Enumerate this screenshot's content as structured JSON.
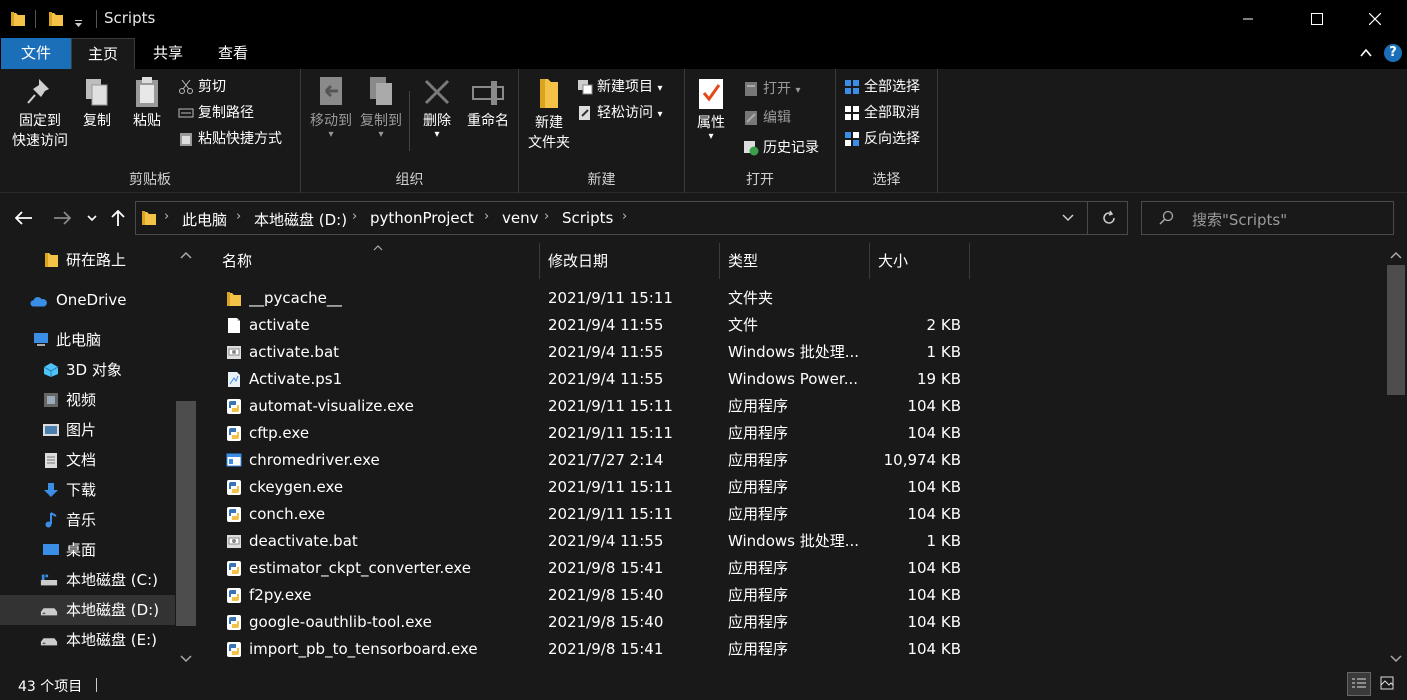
{
  "window": {
    "title": "Scripts"
  },
  "ribbon_tabs": {
    "file": "文件",
    "home": "主页",
    "share": "共享",
    "view": "查看"
  },
  "ribbon": {
    "clipboard": {
      "label": "剪贴板",
      "pin_line1": "固定到",
      "pin_line2": "快速访问",
      "copy": "复制",
      "paste": "粘贴",
      "cut": "剪切",
      "copy_path": "复制路径",
      "paste_shortcut": "粘贴快捷方式"
    },
    "organize": {
      "label": "组织",
      "move_to": "移动到",
      "copy_to": "复制到",
      "delete": "删除",
      "rename": "重命名"
    },
    "new": {
      "label": "新建",
      "new_folder_line1": "新建",
      "new_folder_line2": "文件夹",
      "new_item": "新建项目",
      "easy_access": "轻松访问"
    },
    "open": {
      "label": "打开",
      "properties": "属性",
      "open": "打开",
      "edit": "编辑",
      "history": "历史记录"
    },
    "select": {
      "label": "选择",
      "select_all": "全部选择",
      "select_none": "全部取消",
      "invert": "反向选择"
    }
  },
  "address": {
    "crumbs": [
      "此电脑",
      "本地磁盘 (D:)",
      "pythonProject",
      "venv",
      "Scripts"
    ],
    "search_placeholder": "搜索\"Scripts\""
  },
  "nav_pane": {
    "items": [
      {
        "label": "研在路上",
        "icon": "folder-icon"
      },
      {
        "label": "OneDrive",
        "icon": "onedrive-icon"
      },
      {
        "label": "此电脑",
        "icon": "computer-icon"
      },
      {
        "label": "3D 对象",
        "icon": "3d-objects-icon"
      },
      {
        "label": "视频",
        "icon": "videos-icon"
      },
      {
        "label": "图片",
        "icon": "pictures-icon"
      },
      {
        "label": "文档",
        "icon": "documents-icon"
      },
      {
        "label": "下载",
        "icon": "downloads-icon"
      },
      {
        "label": "音乐",
        "icon": "music-icon"
      },
      {
        "label": "桌面",
        "icon": "desktop-icon"
      },
      {
        "label": "本地磁盘 (C:)",
        "icon": "drive-c-icon"
      },
      {
        "label": "本地磁盘 (D:)",
        "icon": "drive-icon"
      },
      {
        "label": "本地磁盘 (E:)",
        "icon": "drive-icon"
      }
    ]
  },
  "columns": {
    "name": "名称",
    "date": "修改日期",
    "type": "类型",
    "size": "大小"
  },
  "files": [
    {
      "name": "__pycache__",
      "date": "2021/9/11 15:11",
      "type": "文件夹",
      "size": "",
      "icon": "folder-icon"
    },
    {
      "name": "activate",
      "date": "2021/9/4 11:55",
      "type": "文件",
      "size": "2 KB",
      "icon": "file-icon"
    },
    {
      "name": "activate.bat",
      "date": "2021/9/4 11:55",
      "type": "Windows 批处理...",
      "size": "1 KB",
      "icon": "batch-icon"
    },
    {
      "name": "Activate.ps1",
      "date": "2021/9/4 11:55",
      "type": "Windows Power...",
      "size": "19 KB",
      "icon": "powershell-icon"
    },
    {
      "name": "automat-visualize.exe",
      "date": "2021/9/11 15:11",
      "type": "应用程序",
      "size": "104 KB",
      "icon": "python-exe-icon"
    },
    {
      "name": "cftp.exe",
      "date": "2021/9/11 15:11",
      "type": "应用程序",
      "size": "104 KB",
      "icon": "python-exe-icon"
    },
    {
      "name": "chromedriver.exe",
      "date": "2021/7/27 2:14",
      "type": "应用程序",
      "size": "10,974 KB",
      "icon": "app-window-icon"
    },
    {
      "name": "ckeygen.exe",
      "date": "2021/9/11 15:11",
      "type": "应用程序",
      "size": "104 KB",
      "icon": "python-exe-icon"
    },
    {
      "name": "conch.exe",
      "date": "2021/9/11 15:11",
      "type": "应用程序",
      "size": "104 KB",
      "icon": "python-exe-icon"
    },
    {
      "name": "deactivate.bat",
      "date": "2021/9/4 11:55",
      "type": "Windows 批处理...",
      "size": "1 KB",
      "icon": "batch-icon"
    },
    {
      "name": "estimator_ckpt_converter.exe",
      "date": "2021/9/8 15:41",
      "type": "应用程序",
      "size": "104 KB",
      "icon": "python-exe-icon"
    },
    {
      "name": "f2py.exe",
      "date": "2021/9/8 15:40",
      "type": "应用程序",
      "size": "104 KB",
      "icon": "python-exe-icon"
    },
    {
      "name": "google-oauthlib-tool.exe",
      "date": "2021/9/8 15:40",
      "type": "应用程序",
      "size": "104 KB",
      "icon": "python-exe-icon"
    },
    {
      "name": "import_pb_to_tensorboard.exe",
      "date": "2021/9/8 15:41",
      "type": "应用程序",
      "size": "104 KB",
      "icon": "python-exe-icon"
    }
  ],
  "status": {
    "item_count": "43 个项目"
  },
  "colors": {
    "accent": "#1a6fb8",
    "background": "#191919",
    "titlebar": "#000000",
    "folder": "#f4c246"
  }
}
